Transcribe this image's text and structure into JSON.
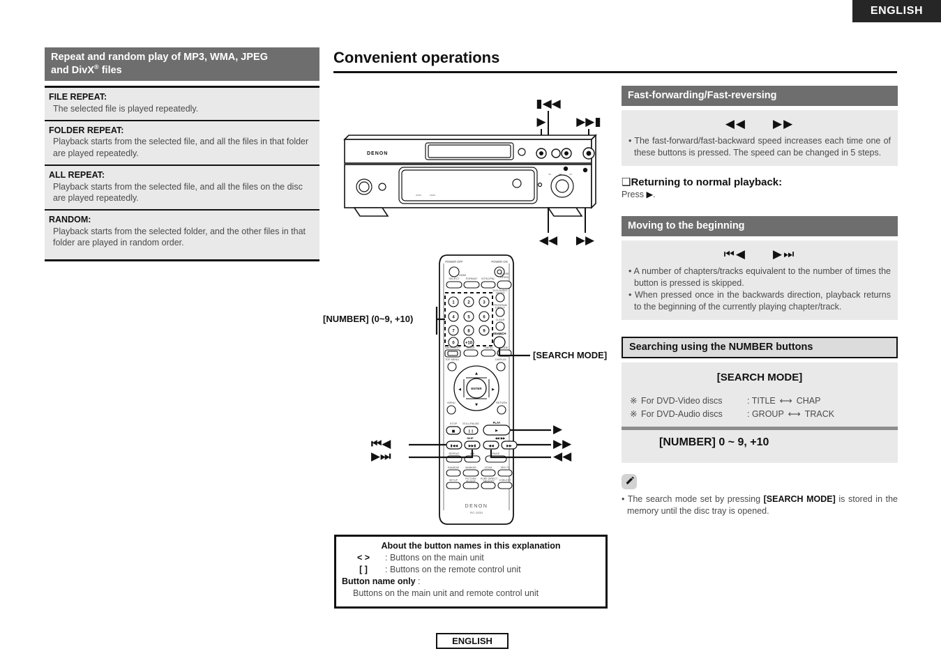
{
  "lang_tab": "ENGLISH",
  "footer_lang": "ENGLISH",
  "page_title": "Convenient operations",
  "left_section": {
    "header_line1": "Repeat and random play of MP3, WMA, JPEG",
    "header_line2_a": "and DivX",
    "header_line2_sup": "®",
    "header_line2_b": " files",
    "items": [
      {
        "term": "FILE REPEAT:",
        "desc": "The selected file is played repeatedly."
      },
      {
        "term": "FOLDER REPEAT:",
        "desc": "Playback starts from the selected file, and all the files in that folder are played repeatedly."
      },
      {
        "term": "ALL REPEAT:",
        "desc": "Playback starts from the selected file, and all the files on the disc are played repeatedly."
      },
      {
        "term": "RANDOM:",
        "desc": "Playback starts from the selected folder, and the other files in that folder are played in random order."
      }
    ]
  },
  "unit_figure": {
    "brand": "DENON",
    "callout_skip_back": "⏮◀",
    "callout_play": "▶",
    "callout_skip_fwd": "▶⏭",
    "callout_rew": "◀◀",
    "callout_ff": "▶▶"
  },
  "remote_figure": {
    "brand": "DENON",
    "model": "RC-1034",
    "callout_number": "[NUMBER] (0~9, +10)",
    "callout_search_mode": "[SEARCH MODE]",
    "callout_play": "▶",
    "callout_ff": "▶▶",
    "callout_rew": "◀◀",
    "callout_skip_back": "⏮◀",
    "callout_skip_fwd": "▶⏭",
    "keys": [
      "1",
      "2",
      "3",
      "4",
      "5",
      "6",
      "7",
      "8",
      "9",
      "0",
      "+10"
    ],
    "labels": {
      "power_off": "POWER OFF",
      "power_on": "POWER ON",
      "select": "SELECT",
      "format": "FORMAT",
      "ntscpal": "NTSC/PAL",
      "open_close": "OPEN/CLOSE",
      "dvd_audio_video": "DVD AUDIO/ VIDEO",
      "program_direct": "PROGRAM DIRECT",
      "clear": "CLEAR",
      "call": "CALL",
      "backlight": "BACKLIGHT",
      "mode": "MODE",
      "search": "SEARCH",
      "t_menu": "T.MENU",
      "mode2": "MODE",
      "top_menu": "TOP MENU",
      "display": "DISPLAY",
      "enter": "ENTER",
      "menu": "MENU",
      "return": "RETURN",
      "stop": "STOP",
      "still_pause": "STILL/PAUSE",
      "play": "PLAY",
      "skip": "SKIP",
      "ff_rew": "◀◀ / ▶▶",
      "repeat": "REPEAT",
      "ab": "A-B",
      "page": "PAGE",
      "random": "RANDOM",
      "marker": "MARKER",
      "zoom": "ZOOM",
      "srs_tsxt": "SRS.TS",
      "setup": "SETUP",
      "picture_adjust": "PICTURE ADJUST",
      "pure_direct_memory": "PURE DIRECT MEMORY",
      "v_select": "V.SELECT"
    }
  },
  "name_box": {
    "title": "About the button names in this explanation",
    "rows": [
      {
        "symbol": "<     >",
        "text": ": Buttons on the main unit"
      },
      {
        "symbol": "[      ]",
        "text": ": Buttons on the remote control unit"
      }
    ],
    "only_label": "Button name only",
    "only_colon": ":",
    "only_text": "Buttons on the main unit and remote control unit"
  },
  "right_sections": {
    "ff_fr": {
      "header": "Fast-forwarding/Fast-reversing",
      "glyphs": "◀◀  ▶▶",
      "bullet": "• The fast-forward/fast-backward speed increases each time one of these buttons is pressed. The speed can be changed in 5 steps.",
      "sub_head": "Returning to normal playback:",
      "sub_note_prefix": "Press ",
      "sub_note_glyph": "▶",
      "sub_note_suffix": "."
    },
    "moving": {
      "header": "Moving to the beginning",
      "glyphs": "⏮◀  ▶⏭",
      "bullets": [
        "• A number of chapters/tracks equivalent to the number of times the button is pressed is skipped.",
        "• When pressed once in the backwards direction, playback returns to the beginning of the currently playing chapter/track."
      ]
    },
    "searching": {
      "header": "Searching using the NUMBER buttons",
      "search_mode_label": "[SEARCH MODE]",
      "rows": [
        {
          "mark": "※",
          "label": "For DVD-Video discs",
          "value_a": ": TITLE",
          "arrow": "⟷",
          "value_b": "CHAP"
        },
        {
          "mark": "※",
          "label": "For DVD-Audio discs",
          "value_a": ": GROUP",
          "arrow": "⟷",
          "value_b": "TRACK"
        }
      ],
      "number_text": "[NUMBER]  0 ~ 9, +10"
    },
    "note": {
      "icon": "pencil-icon",
      "text_a": "• The search mode set by pressing ",
      "text_bold": "[SEARCH MODE]",
      "text_b": " is stored in the memory until the disc tray is opened."
    }
  },
  "colors": {
    "header_dark": "#6e6e6e",
    "header_light": "#dcdcdc",
    "panel_gray": "#e9e9e9",
    "divider_gray": "#8d8d8d",
    "ink": "#111111",
    "body_text": "#4a4a4a"
  }
}
